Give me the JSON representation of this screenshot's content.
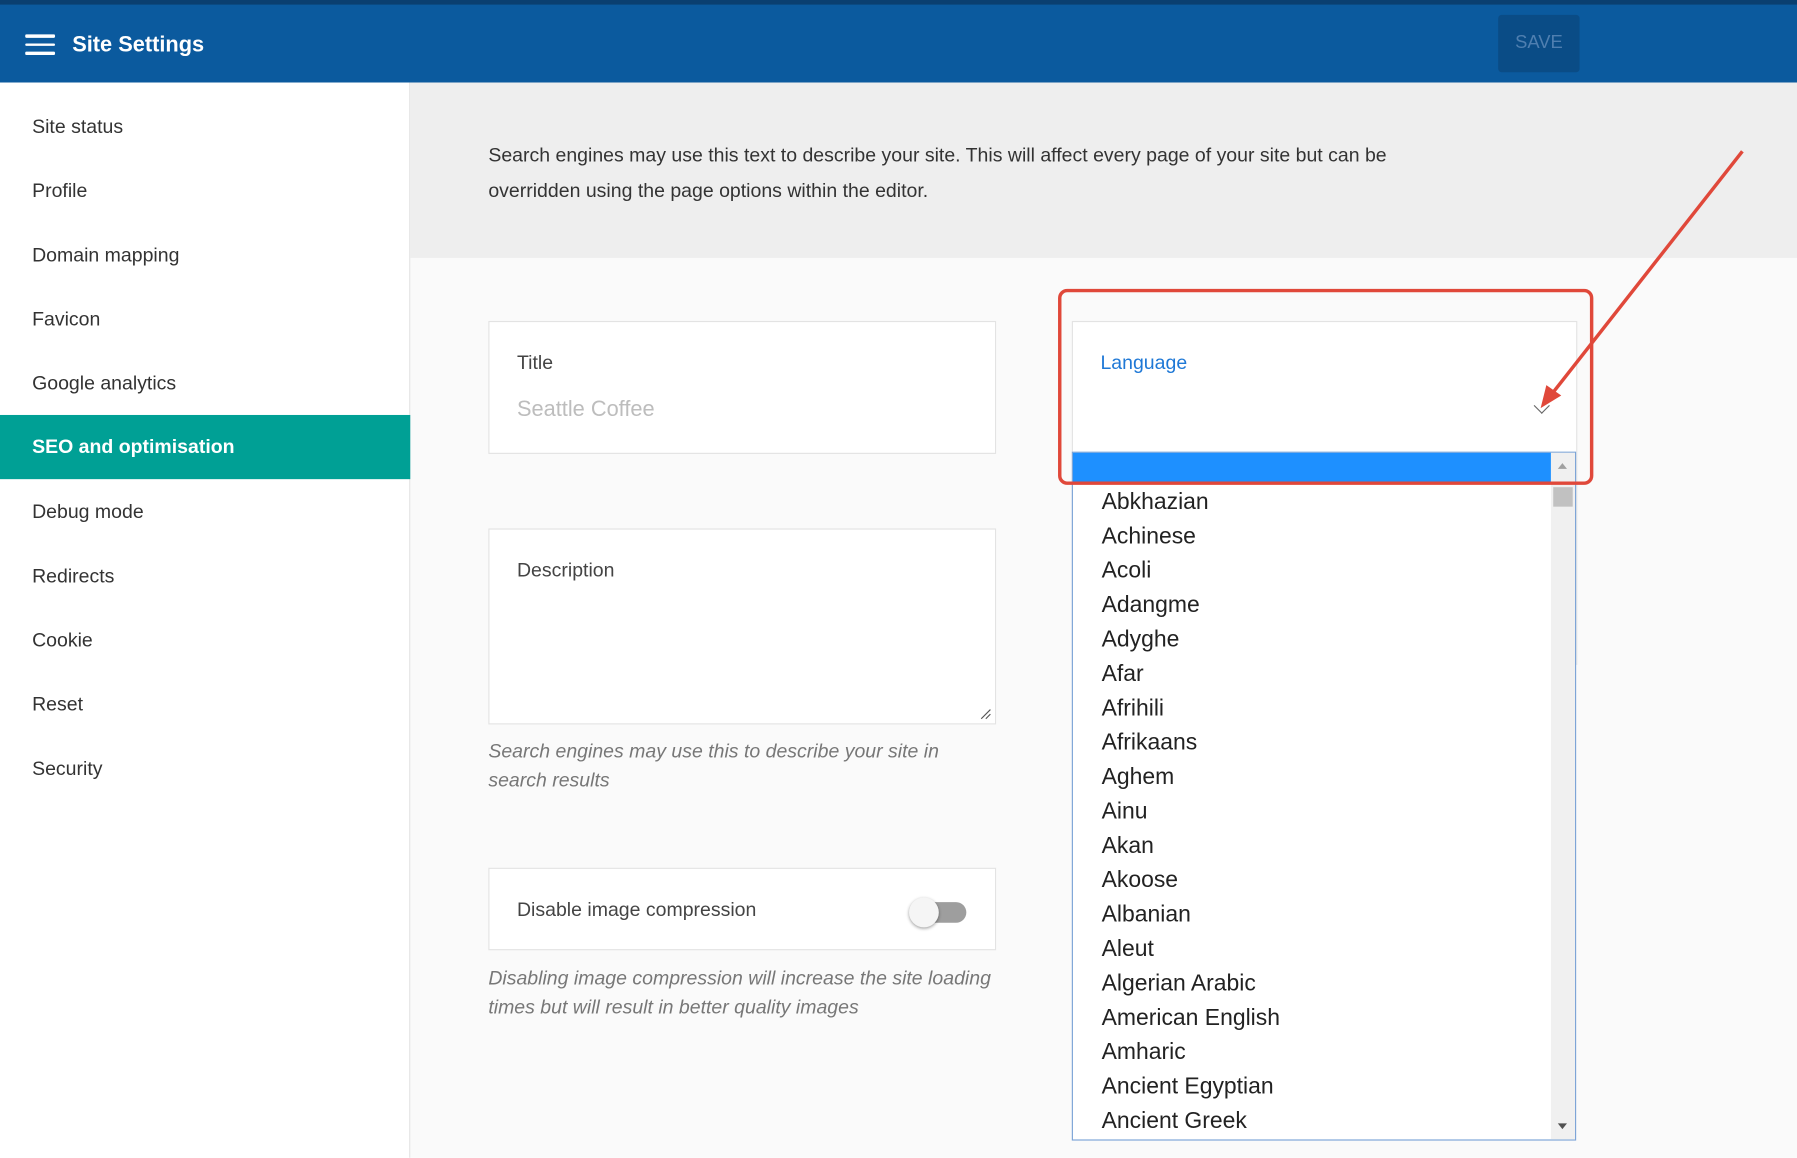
{
  "header": {
    "title": "Site Settings",
    "save_label": "SAVE"
  },
  "sidebar": {
    "items": [
      {
        "label": "Site status"
      },
      {
        "label": "Profile"
      },
      {
        "label": "Domain mapping"
      },
      {
        "label": "Favicon"
      },
      {
        "label": "Google analytics"
      },
      {
        "label": "SEO and optimisation",
        "active": true
      },
      {
        "label": "Debug mode"
      },
      {
        "label": "Redirects"
      },
      {
        "label": "Cookie"
      },
      {
        "label": "Reset"
      },
      {
        "label": "Security"
      }
    ]
  },
  "main": {
    "intro": "Search engines may use this text to describe your site. This will affect every page of your site but can be overridden using the page options within the editor.",
    "title_field": {
      "label": "Title",
      "value": "Seattle Coffee"
    },
    "description_field": {
      "label": "Description",
      "hint": "Search engines may use this to describe your site in search results"
    },
    "compression": {
      "label": "Disable image compression",
      "enabled": false,
      "hint": "Disabling image compression will increase the site loading times but will result in better quality images"
    },
    "language": {
      "label": "Language",
      "options": [
        "Abkhazian",
        "Achinese",
        "Acoli",
        "Adangme",
        "Adyghe",
        "Afar",
        "Afrihili",
        "Afrikaans",
        "Aghem",
        "Ainu",
        "Akan",
        "Akoose",
        "Albanian",
        "Aleut",
        "Algerian Arabic",
        "American English",
        "Amharic",
        "Ancient Egyptian",
        "Ancient Greek"
      ]
    }
  },
  "colors": {
    "header": "#0b5a9e",
    "active": "#00a095",
    "highlight": "#e0483a",
    "selected": "#1e90ff"
  }
}
